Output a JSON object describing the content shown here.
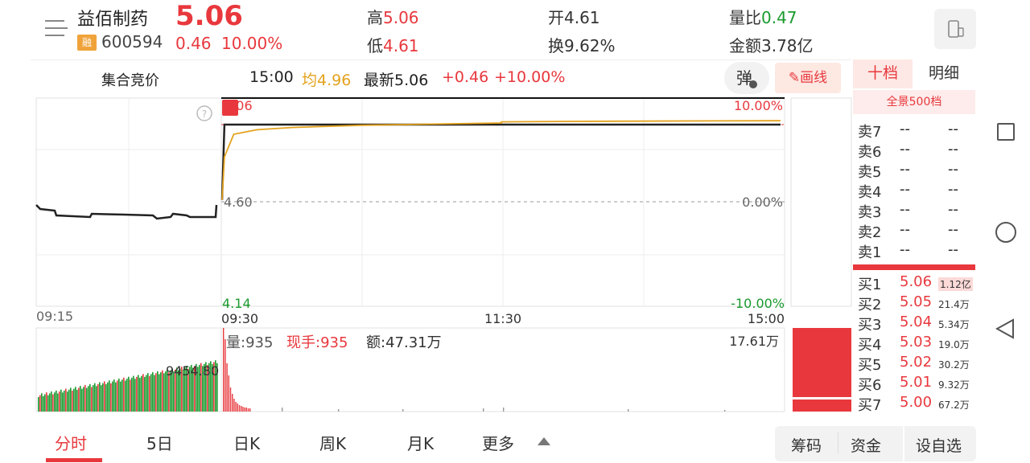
{
  "header": {
    "name": "益佰制药",
    "badge": "融",
    "code": "600594",
    "price": "5.06",
    "change": "0.46",
    "change_pct": "10.00%",
    "stats": [
      {
        "label": "高",
        "value": "5.06"
      },
      {
        "label": "低",
        "value": "4.61"
      },
      {
        "label": "开",
        "value": "4.61"
      },
      {
        "label": "换",
        "value": "9.62%"
      },
      {
        "label": "量比",
        "value": "0.47"
      },
      {
        "label": "金额",
        "value": "3.78亿"
      }
    ]
  },
  "auction": {
    "label": "集合竞价",
    "time": "15:00",
    "avg": "均4.96",
    "latest": "最新5.06",
    "change": "+0.46",
    "pct": "+10.00%",
    "dan_label": "弹",
    "draw_label": "画线"
  },
  "chart": {
    "top_price": "5.06",
    "top_pct": "10.00%",
    "mid_price": "4.60",
    "mid_pct": "0.00%",
    "low_price": "4.14",
    "low_pct": "-10.00%",
    "x_labels": [
      "09:15",
      "09:30",
      "11:30",
      "15:00"
    ],
    "pre_vol_label": "9454.80",
    "vol_label": "量:935",
    "hand_label": "现手:935",
    "amount_label": "额:47.31万",
    "max_vol_label": "17.61万"
  },
  "chart_data": {
    "type": "line",
    "series": [
      {
        "name": "最新",
        "x": [
          "09:30",
          "09:31",
          "09:35",
          "09:45",
          "10:00",
          "10:30",
          "11:00",
          "11:30",
          "13:00",
          "13:30",
          "14:00",
          "14:30",
          "15:00"
        ],
        "values": [
          4.61,
          5.06,
          5.06,
          5.06,
          5.06,
          5.06,
          5.06,
          5.06,
          5.06,
          5.06,
          5.06,
          5.06,
          5.06
        ]
      },
      {
        "name": "均",
        "x": [
          "09:30",
          "09:31",
          "09:35",
          "09:45",
          "10:00",
          "10:30",
          "11:00",
          "11:30",
          "13:00",
          "13:30",
          "14:00",
          "14:30",
          "15:00"
        ],
        "values": [
          4.61,
          4.8,
          4.9,
          4.92,
          4.93,
          4.94,
          4.945,
          4.95,
          4.955,
          4.957,
          4.958,
          4.959,
          4.96
        ]
      }
    ],
    "ylim": [
      4.14,
      5.06
    ]
  },
  "orderbook": {
    "tab_10": "十档",
    "tab_detail": "明细",
    "panorama": "全景500档",
    "sells": [
      {
        "label": "卖7",
        "price": "--",
        "qty": "--"
      },
      {
        "label": "卖6",
        "price": "--",
        "qty": "--"
      },
      {
        "label": "卖5",
        "price": "--",
        "qty": "--"
      },
      {
        "label": "卖4",
        "price": "--",
        "qty": "--"
      },
      {
        "label": "卖3",
        "price": "--",
        "qty": "--"
      },
      {
        "label": "卖2",
        "price": "--",
        "qty": "--"
      },
      {
        "label": "卖1",
        "price": "--",
        "qty": "--"
      }
    ],
    "buys": [
      {
        "label": "买1",
        "price": "5.06",
        "qty": "1.12亿"
      },
      {
        "label": "买2",
        "price": "5.05",
        "qty": "21.4万"
      },
      {
        "label": "买3",
        "price": "5.04",
        "qty": "5.34万"
      },
      {
        "label": "买4",
        "price": "5.03",
        "qty": "19.0万"
      },
      {
        "label": "买5",
        "price": "5.02",
        "qty": "30.2万"
      },
      {
        "label": "买6",
        "price": "5.01",
        "qty": "9.32万"
      },
      {
        "label": "买7",
        "price": "5.00",
        "qty": "67.2万"
      }
    ]
  },
  "bottom_tabs": [
    "分时",
    "5日",
    "日K",
    "周K",
    "月K",
    "更多"
  ],
  "bottom_buttons": [
    "筹码",
    "资金",
    "设自选"
  ],
  "colors": {
    "up": "#e8383d",
    "down": "#1a9a2e",
    "avg": "#e4a21d"
  }
}
